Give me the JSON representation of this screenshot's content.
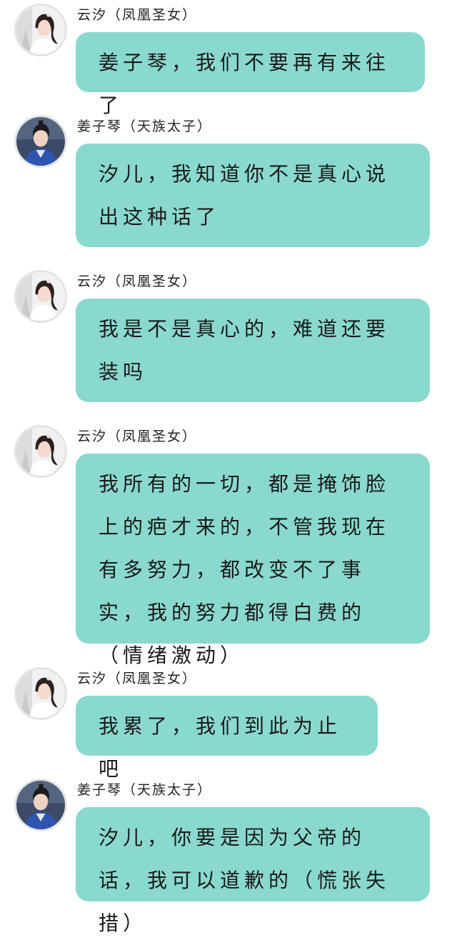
{
  "messages": [
    {
      "sender": "云汐（凤凰圣女）",
      "avatar": "female-avatar-icon",
      "text": "姜子琴，我们不要再有来往了"
    },
    {
      "sender": "姜子琴（天族太子）",
      "avatar": "male-avatar-icon",
      "text": "汐儿，我知道你不是真心说出这种话了"
    },
    {
      "sender": "云汐（凤凰圣女）",
      "avatar": "female-avatar-icon",
      "text": "我是不是真心的，难道还要装吗"
    },
    {
      "sender": "云汐（凤凰圣女）",
      "avatar": "female-avatar-icon",
      "text": "我所有的一切，都是掩饰脸上的疤才来的，不管我现在有多努力，都改变不了事实，我的努力都得白费的（情绪激动）"
    },
    {
      "sender": "云汐（凤凰圣女）",
      "avatar": "female-avatar-icon",
      "text": "我累了，我们到此为止吧"
    },
    {
      "sender": "姜子琴（天族太子）",
      "avatar": "male-avatar-icon",
      "text": "汐儿，你要是因为父帝的话，我可以道歉的（慌张失措）"
    }
  ],
  "colors": {
    "bubble": "#8ad9cf",
    "background": "#ffffff",
    "text": "#1a1a1a"
  }
}
